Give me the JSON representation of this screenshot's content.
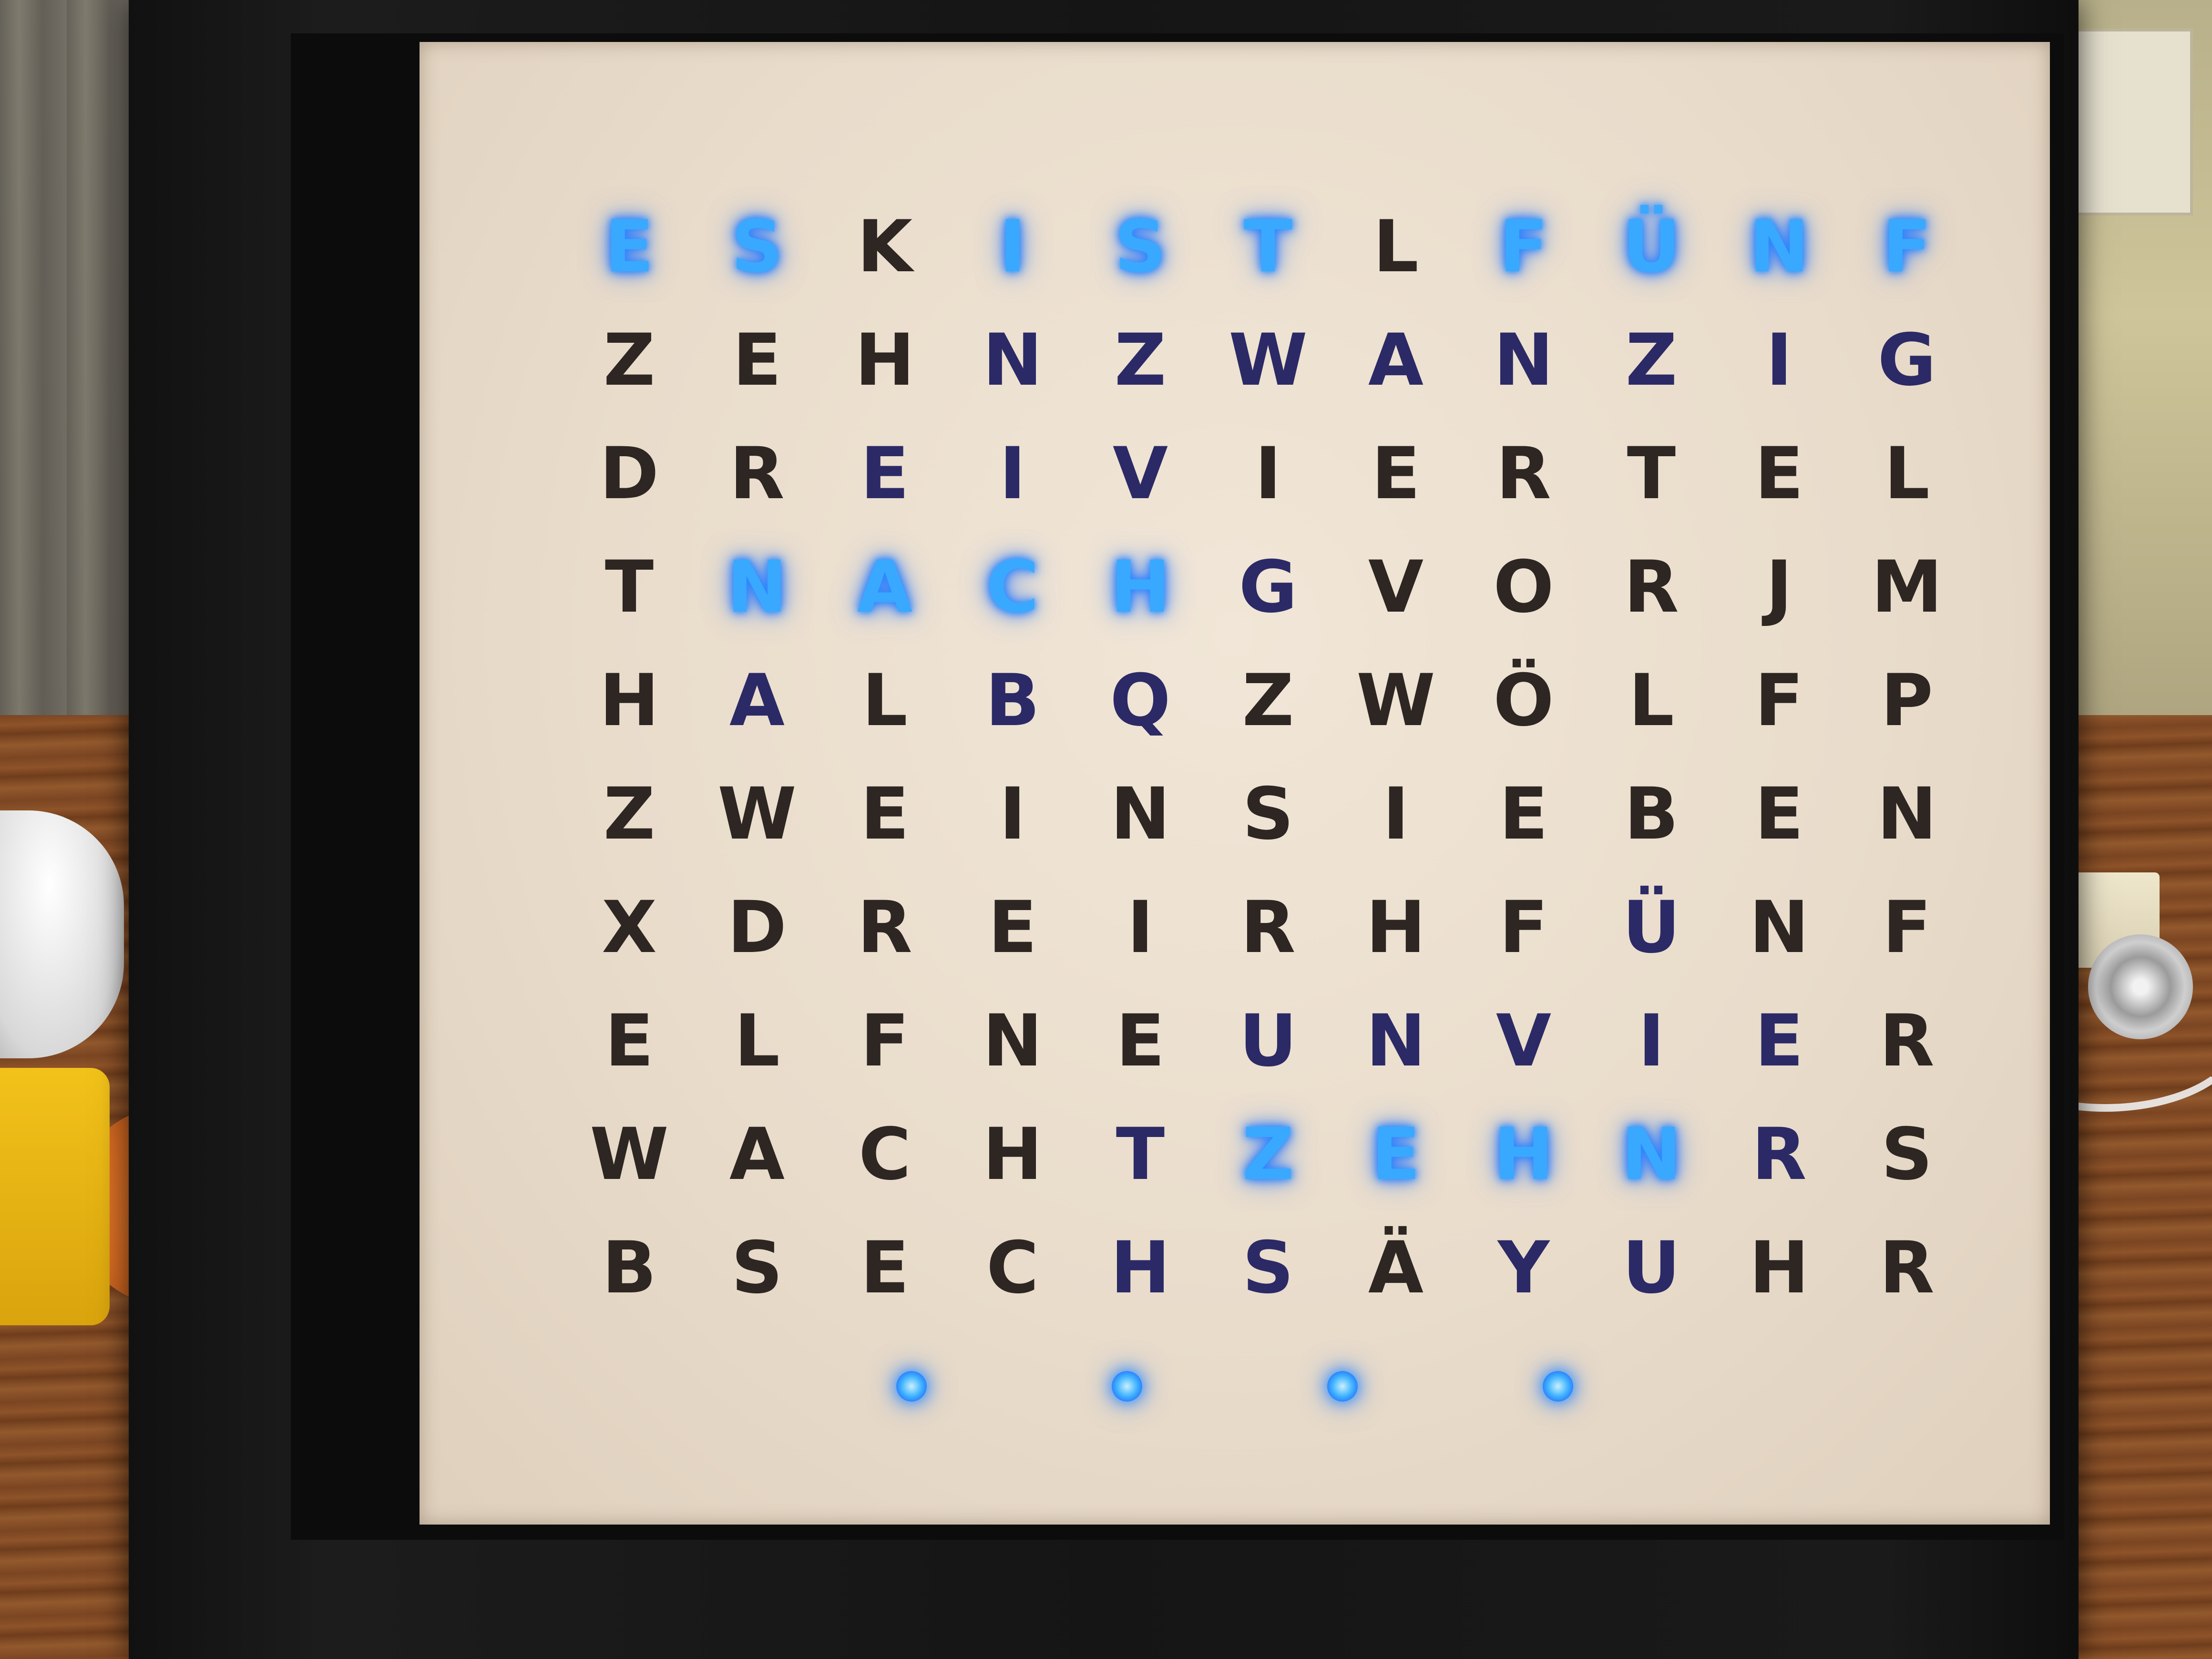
{
  "clock": {
    "rows": [
      {
        "letters": [
          "E",
          "S",
          "K",
          "I",
          "S",
          "T",
          "L",
          "F",
          "Ü",
          "N",
          "F"
        ],
        "lit": [
          1,
          1,
          0,
          1,
          1,
          1,
          0,
          1,
          1,
          1,
          1
        ]
      },
      {
        "letters": [
          "Z",
          "E",
          "H",
          "N",
          "Z",
          "W",
          "A",
          "N",
          "Z",
          "I",
          "G"
        ],
        "lit": [
          0,
          0,
          0,
          2,
          2,
          2,
          2,
          2,
          2,
          2,
          2
        ]
      },
      {
        "letters": [
          "D",
          "R",
          "E",
          "I",
          "V",
          "I",
          "E",
          "R",
          "T",
          "E",
          "L"
        ],
        "lit": [
          0,
          0,
          2,
          2,
          2,
          0,
          0,
          0,
          0,
          0,
          0
        ]
      },
      {
        "letters": [
          "T",
          "N",
          "A",
          "C",
          "H",
          "G",
          "V",
          "O",
          "R",
          "J",
          "M"
        ],
        "lit": [
          0,
          1,
          1,
          1,
          1,
          2,
          0,
          0,
          0,
          0,
          0
        ]
      },
      {
        "letters": [
          "H",
          "A",
          "L",
          "B",
          "Q",
          "Z",
          "W",
          "Ö",
          "L",
          "F",
          "P"
        ],
        "lit": [
          0,
          2,
          0,
          2,
          2,
          0,
          0,
          0,
          0,
          0,
          0
        ]
      },
      {
        "letters": [
          "Z",
          "W",
          "E",
          "I",
          "N",
          "S",
          "I",
          "E",
          "B",
          "E",
          "N"
        ],
        "lit": [
          0,
          0,
          0,
          0,
          0,
          0,
          0,
          0,
          0,
          0,
          0
        ]
      },
      {
        "letters": [
          "X",
          "D",
          "R",
          "E",
          "I",
          "R",
          "H",
          "F",
          "Ü",
          "N",
          "F"
        ],
        "lit": [
          0,
          0,
          0,
          0,
          0,
          0,
          0,
          0,
          2,
          0,
          0
        ]
      },
      {
        "letters": [
          "E",
          "L",
          "F",
          "N",
          "E",
          "U",
          "N",
          "V",
          "I",
          "E",
          "R"
        ],
        "lit": [
          0,
          0,
          0,
          0,
          0,
          2,
          2,
          2,
          2,
          2,
          0
        ]
      },
      {
        "letters": [
          "W",
          "A",
          "C",
          "H",
          "T",
          "Z",
          "E",
          "H",
          "N",
          "R",
          "S"
        ],
        "lit": [
          0,
          0,
          0,
          0,
          2,
          1,
          1,
          1,
          1,
          2,
          0
        ]
      },
      {
        "letters": [
          "B",
          "S",
          "E",
          "C",
          "H",
          "S",
          "Ä",
          "Y",
          "U",
          "H",
          "R"
        ],
        "lit": [
          0,
          0,
          0,
          0,
          2,
          2,
          0,
          2,
          2,
          0,
          0
        ]
      }
    ],
    "minute_dots": 4,
    "colors": {
      "lit": "#39a9ff",
      "unlit": "#2d2622",
      "dim": "#2b2a66",
      "panel": "#ece0cf",
      "frame": "#151515"
    }
  }
}
